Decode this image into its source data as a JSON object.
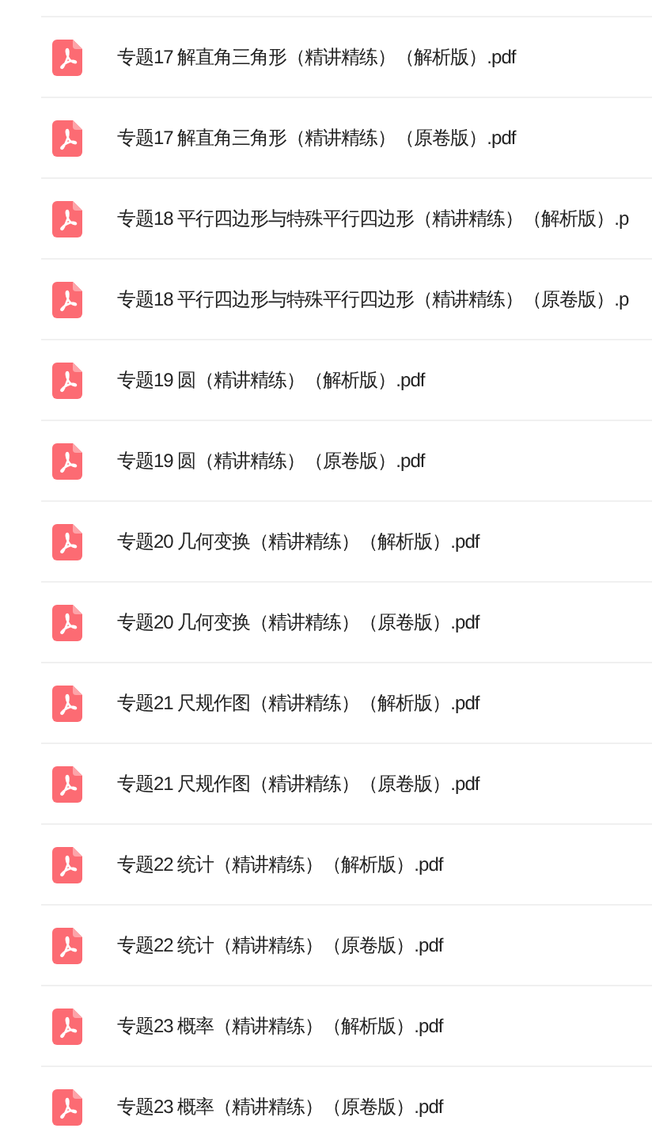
{
  "files": [
    {
      "name": "专题17 解直角三角形（精讲精练）（解析版）.pdf"
    },
    {
      "name": "专题17 解直角三角形（精讲精练）（原卷版）.pdf"
    },
    {
      "name": "专题18 平行四边形与特殊平行四边形（精讲精练）（解析版）.p"
    },
    {
      "name": "专题18 平行四边形与特殊平行四边形（精讲精练）（原卷版）.p"
    },
    {
      "name": "专题19 圆（精讲精练）（解析版）.pdf"
    },
    {
      "name": "专题19 圆（精讲精练）（原卷版）.pdf"
    },
    {
      "name": "专题20 几何变换（精讲精练）（解析版）.pdf"
    },
    {
      "name": "专题20 几何变换（精讲精练）（原卷版）.pdf"
    },
    {
      "name": "专题21 尺规作图（精讲精练）（解析版）.pdf"
    },
    {
      "name": "专题21 尺规作图（精讲精练）（原卷版）.pdf"
    },
    {
      "name": "专题22 统计（精讲精练）（解析版）.pdf"
    },
    {
      "name": "专题22 统计（精讲精练）（原卷版）.pdf"
    },
    {
      "name": "专题23 概率（精讲精练）（解析版）.pdf"
    },
    {
      "name": "专题23 概率（精讲精练）（原卷版）.pdf"
    }
  ]
}
